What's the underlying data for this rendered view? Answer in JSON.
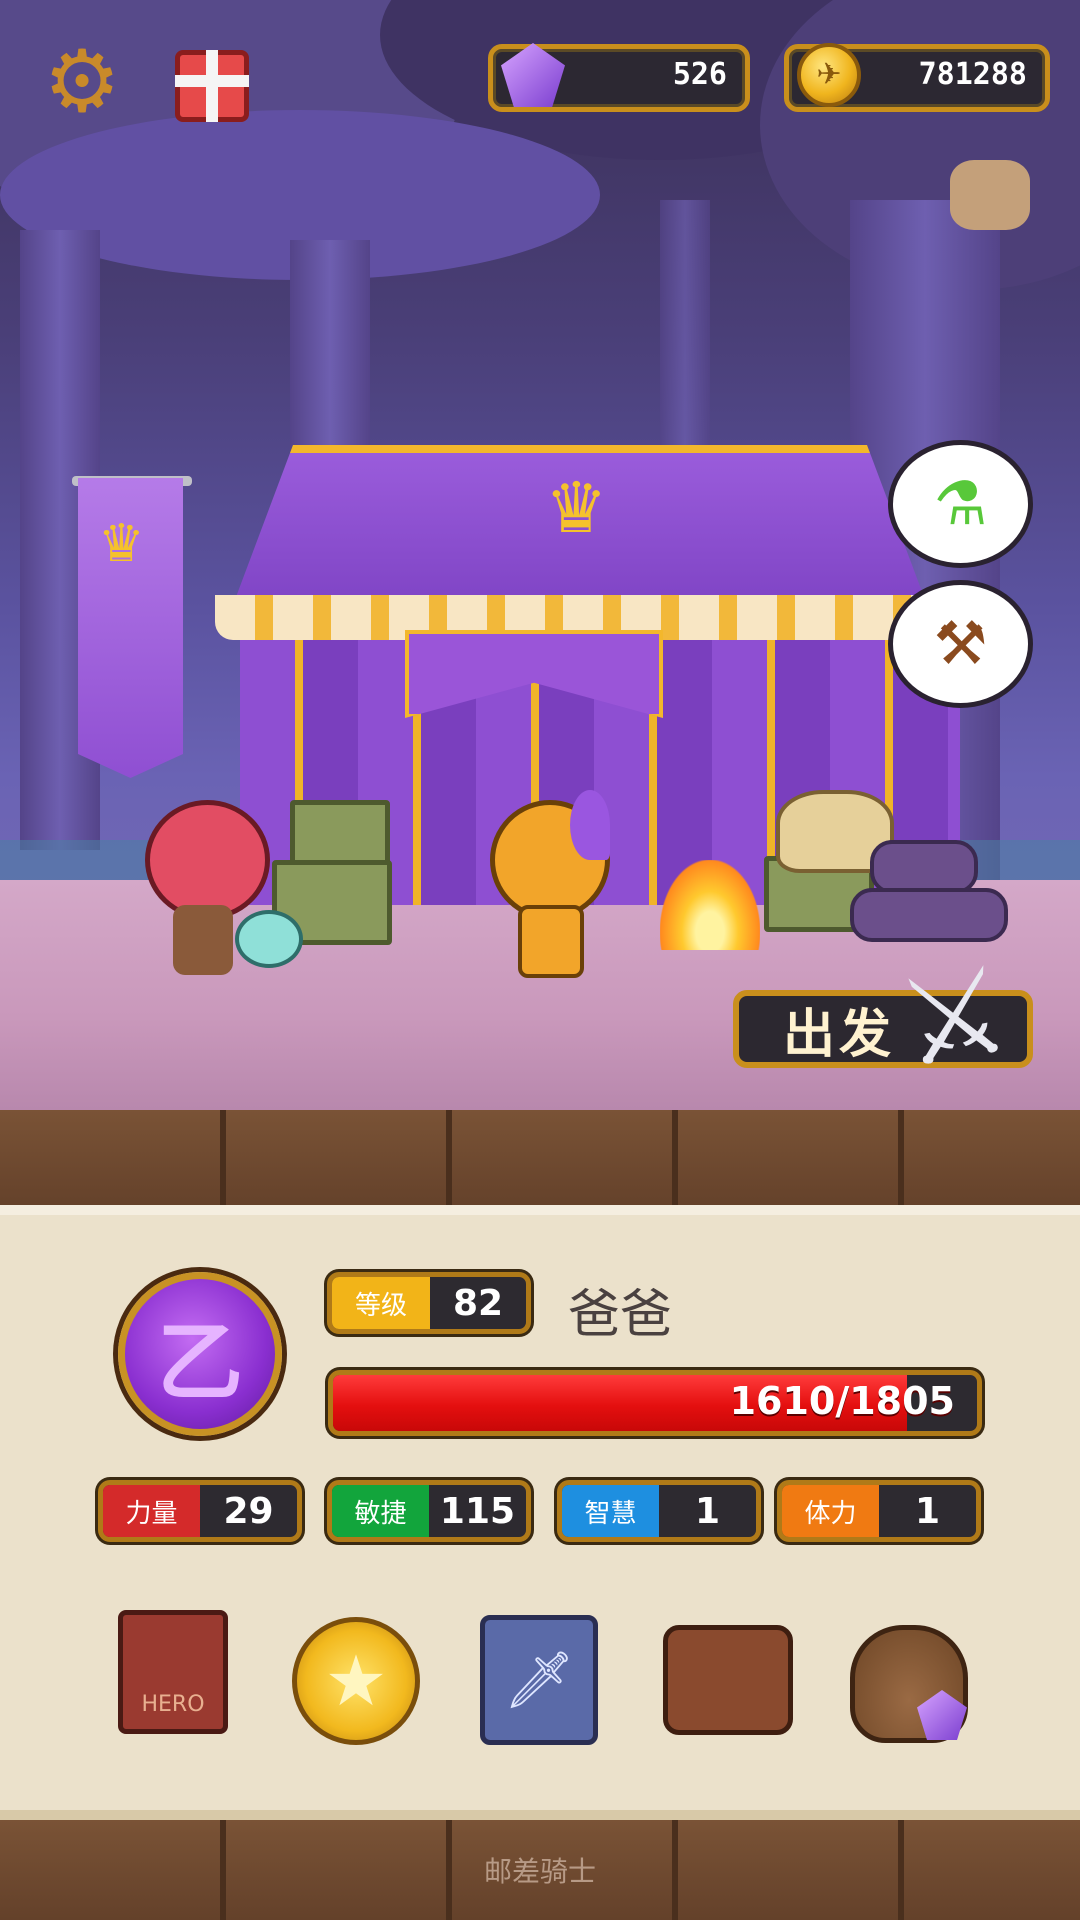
{
  "hud": {
    "gems": "526",
    "gold": "781288",
    "icons": [
      "settings-gear-icon",
      "gift-box-icon",
      "gem-icon",
      "gold-coin-icon"
    ]
  },
  "scene": {
    "depart_label": "出发",
    "bubble_icons": [
      "potion-upgrade-icon",
      "hammer-icon"
    ]
  },
  "character": {
    "level_label": "等级",
    "level": "82",
    "name": "爸爸",
    "emblem_glyph": "乙",
    "hp_text": "1610/1805",
    "hp_fraction": 0.892
  },
  "stats": [
    {
      "label": "力量",
      "value": "29",
      "color": "#d42a2a"
    },
    {
      "label": "敏捷",
      "value": "115",
      "color": "#12a53c"
    },
    {
      "label": "智慧",
      "value": "1",
      "color": "#1e8fe0"
    },
    {
      "label": "体力",
      "value": "1",
      "color": "#f07a12"
    }
  ],
  "menu_icons": [
    "hero-book-icon",
    "star-coin-icon",
    "skill-cards-icon",
    "inventory-bag-icon",
    "loot-sack-icon"
  ],
  "footer": {
    "text": "邮差骑士"
  }
}
